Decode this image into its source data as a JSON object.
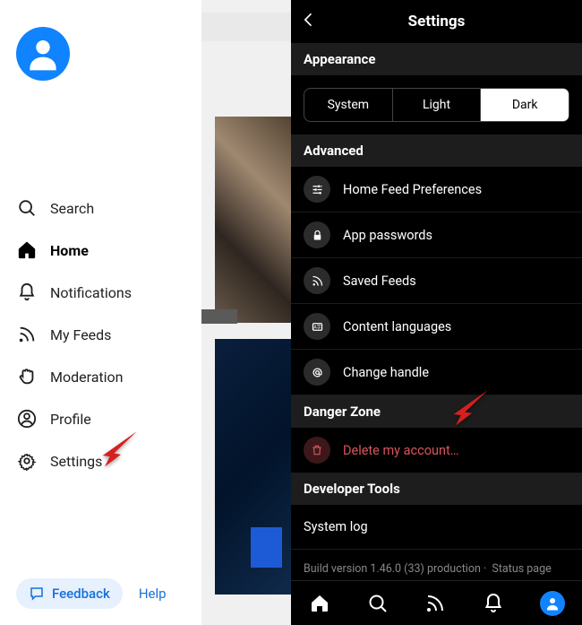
{
  "sidebar": {
    "items": [
      {
        "label": "Search"
      },
      {
        "label": "Home"
      },
      {
        "label": "Notifications"
      },
      {
        "label": "My Feeds"
      },
      {
        "label": "Moderation"
      },
      {
        "label": "Profile"
      },
      {
        "label": "Settings"
      }
    ],
    "feedback": "Feedback",
    "help": "Help"
  },
  "settings": {
    "title": "Settings",
    "appearance": {
      "header": "Appearance",
      "options": [
        "System",
        "Light",
        "Dark"
      ],
      "selected": "Dark"
    },
    "advanced": {
      "header": "Advanced",
      "rows": [
        "Home Feed Preferences",
        "App passwords",
        "Saved Feeds",
        "Content languages",
        "Change handle"
      ]
    },
    "danger": {
      "header": "Danger Zone",
      "delete": "Delete my account…"
    },
    "dev": {
      "header": "Developer Tools",
      "syslog": "System log"
    },
    "build_version": "Build version 1.46.0 (33) production ·",
    "status_page": "Status page"
  },
  "colors": {
    "accent": "#1083fe",
    "danger": "#d9545d"
  }
}
